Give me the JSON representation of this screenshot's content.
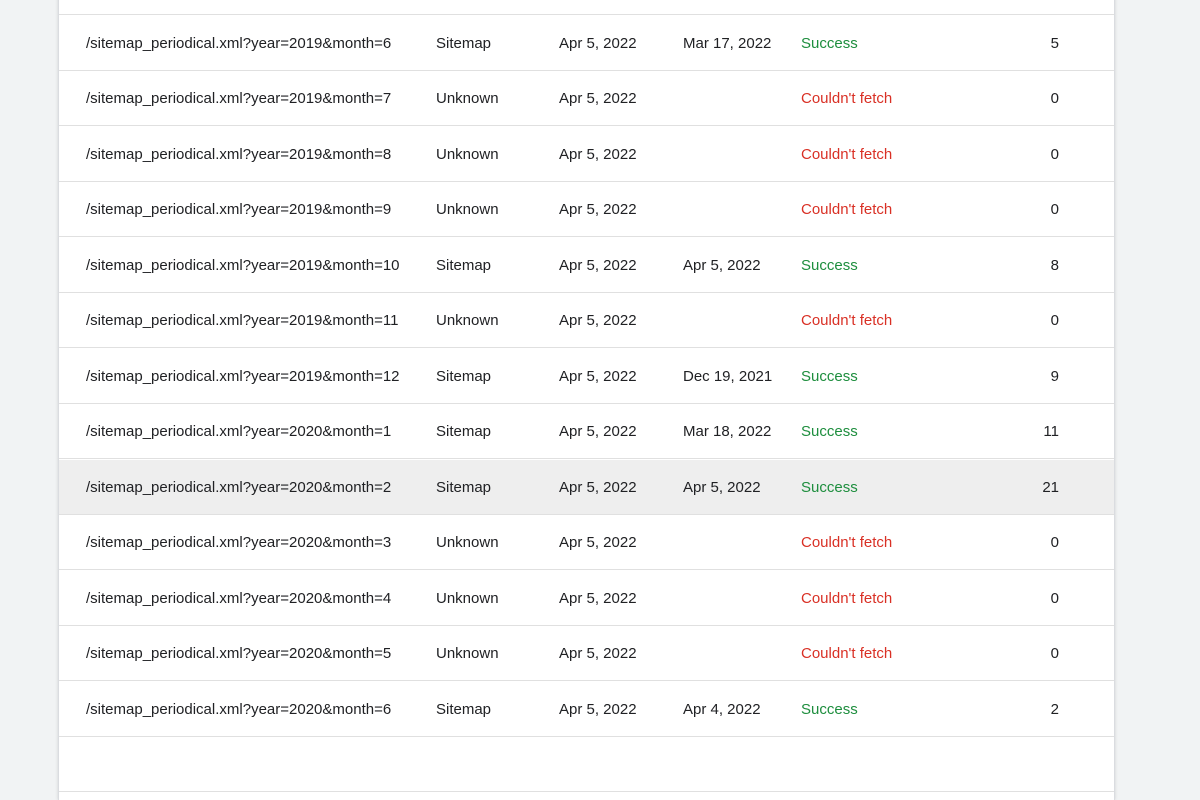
{
  "colors": {
    "success": "#1e8e3e",
    "error": "#d93025",
    "highlight_row": "#eeeeee"
  },
  "rows": [
    {
      "path": "",
      "type": "",
      "submitted": "",
      "last_read": "",
      "status": "",
      "status_kind": "none",
      "urls": ""
    },
    {
      "path": "/sitemap_periodical.xml?year=2019&month=6",
      "type": "Sitemap",
      "submitted": "Apr 5, 2022",
      "last_read": "Mar 17, 2022",
      "status": "Success",
      "status_kind": "success",
      "urls": "5"
    },
    {
      "path": "/sitemap_periodical.xml?year=2019&month=7",
      "type": "Unknown",
      "submitted": "Apr 5, 2022",
      "last_read": "",
      "status": "Couldn't fetch",
      "status_kind": "fail",
      "urls": "0"
    },
    {
      "path": "/sitemap_periodical.xml?year=2019&month=8",
      "type": "Unknown",
      "submitted": "Apr 5, 2022",
      "last_read": "",
      "status": "Couldn't fetch",
      "status_kind": "fail",
      "urls": "0"
    },
    {
      "path": "/sitemap_periodical.xml?year=2019&month=9",
      "type": "Unknown",
      "submitted": "Apr 5, 2022",
      "last_read": "",
      "status": "Couldn't fetch",
      "status_kind": "fail",
      "urls": "0"
    },
    {
      "path": "/sitemap_periodical.xml?year=2019&month=10",
      "type": "Sitemap",
      "submitted": "Apr 5, 2022",
      "last_read": "Apr 5, 2022",
      "status": "Success",
      "status_kind": "success",
      "urls": "8"
    },
    {
      "path": "/sitemap_periodical.xml?year=2019&month=11",
      "type": "Unknown",
      "submitted": "Apr 5, 2022",
      "last_read": "",
      "status": "Couldn't fetch",
      "status_kind": "fail",
      "urls": "0"
    },
    {
      "path": "/sitemap_periodical.xml?year=2019&month=12",
      "type": "Sitemap",
      "submitted": "Apr 5, 2022",
      "last_read": "Dec 19, 2021",
      "status": "Success",
      "status_kind": "success",
      "urls": "9"
    },
    {
      "path": "/sitemap_periodical.xml?year=2020&month=1",
      "type": "Sitemap",
      "submitted": "Apr 5, 2022",
      "last_read": "Mar 18, 2022",
      "status": "Success",
      "status_kind": "success",
      "urls": "11"
    },
    {
      "path": "/sitemap_periodical.xml?year=2020&month=2",
      "type": "Sitemap",
      "submitted": "Apr 5, 2022",
      "last_read": "Apr 5, 2022",
      "status": "Success",
      "status_kind": "success",
      "urls": "21",
      "highlighted": true
    },
    {
      "path": "/sitemap_periodical.xml?year=2020&month=3",
      "type": "Unknown",
      "submitted": "Apr 5, 2022",
      "last_read": "",
      "status": "Couldn't fetch",
      "status_kind": "fail",
      "urls": "0"
    },
    {
      "path": "/sitemap_periodical.xml?year=2020&month=4",
      "type": "Unknown",
      "submitted": "Apr 5, 2022",
      "last_read": "",
      "status": "Couldn't fetch",
      "status_kind": "fail",
      "urls": "0"
    },
    {
      "path": "/sitemap_periodical.xml?year=2020&month=5",
      "type": "Unknown",
      "submitted": "Apr 5, 2022",
      "last_read": "",
      "status": "Couldn't fetch",
      "status_kind": "fail",
      "urls": "0"
    },
    {
      "path": "/sitemap_periodical.xml?year=2020&month=6",
      "type": "Sitemap",
      "submitted": "Apr 5, 2022",
      "last_read": "Apr 4, 2022",
      "status": "Success",
      "status_kind": "success",
      "urls": "2"
    },
    {
      "path": "",
      "type": "",
      "submitted": "",
      "last_read": "",
      "status": "",
      "status_kind": "none",
      "urls": ""
    }
  ]
}
